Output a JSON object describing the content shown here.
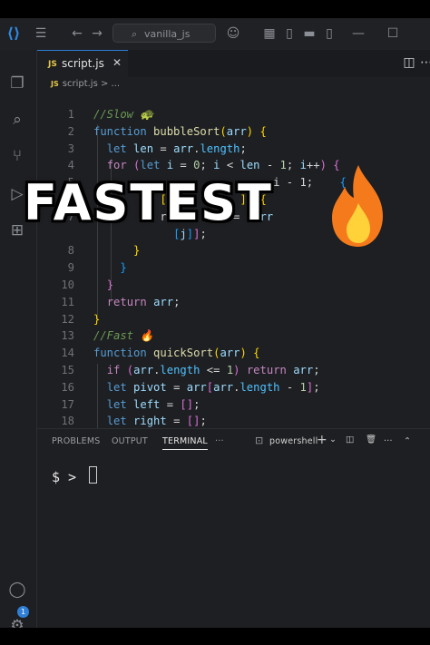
{
  "titlebar": {
    "search_text": "vanilla_js"
  },
  "tab": {
    "badge": "JS",
    "name": "script.js",
    "close": "✕"
  },
  "breadcrumb": {
    "file": "script.js",
    "trail": "> ..."
  },
  "code_lines": [
    {
      "n": "1",
      "html": "<span class='cm'>//Slow 🐢</span>"
    },
    {
      "n": "2",
      "html": "<span class='kb'>function</span> <span class='fn'>bubbleSort</span><span class='b1'>(</span><span class='vr'>arr</span><span class='b1'>)</span> <span class='b1'>{</span>"
    },
    {
      "n": "3",
      "html": "  <span class='kb'>let</span> <span class='vr'>len</span> = <span class='vr'>arr</span>.<span class='pr'>length</span>;"
    },
    {
      "n": "4",
      "html": "  <span class='kw'>for</span> <span class='b2'>(</span><span class='kb'>let</span> <span class='vr'>i</span> = <span class='nm'>0</span>; <span class='vr'>i</span> &lt; <span class='vr'>len</span> - <span class='nm'>1</span>; <span class='vr'>i</span>++<span class='b2'>)</span> <span class='b2'>{</span>"
    },
    {
      "n": "5",
      "html": "                           i - 1;    <span class='b3'>{</span>"
    },
    {
      "n": "6",
      "html": "          <span class='b1'>[</span>           <span class='b1'>])</span> <span class='b1'>{</span>"
    },
    {
      "n": "7",
      "html": "          r          = <span class='b2'>[</span><span class='vr'>arr</span>          <span class='vr'>arr</span>"
    },
    {
      "n": "",
      "html": "            <span class='b3'>[</span><span class='vr'>j</span><span class='b3'>]</span><span class='b2'>]</span>;"
    },
    {
      "n": "8",
      "html": "      <span class='b1'>}</span>"
    },
    {
      "n": "9",
      "html": "    <span class='b3'>}</span>"
    },
    {
      "n": "10",
      "html": "  <span class='b2'>}</span>"
    },
    {
      "n": "11",
      "html": "  <span class='kw'>return</span> <span class='vr'>arr</span>;"
    },
    {
      "n": "12",
      "html": "<span class='b1'>}</span>"
    },
    {
      "n": "13",
      "html": "<span class='cm'>//Fast 🔥</span>"
    },
    {
      "n": "14",
      "html": "<span class='kb'>function</span> <span class='fn'>quickSort</span><span class='b1'>(</span><span class='vr'>arr</span><span class='b1'>)</span> <span class='b1'>{</span>"
    },
    {
      "n": "15",
      "html": "  <span class='kw'>if</span> <span class='b2'>(</span><span class='vr'>arr</span>.<span class='pr'>length</span> &lt;= <span class='nm'>1</span><span class='b2'>)</span> <span class='kw'>return</span> <span class='vr'>arr</span>;"
    },
    {
      "n": "16",
      "html": "  <span class='kb'>let</span> <span class='vr'>pivot</span> = <span class='vr'>arr</span><span class='b2'>[</span><span class='vr'>arr</span>.<span class='pr'>length</span> - <span class='nm'>1</span><span class='b2'>]</span>;"
    },
    {
      "n": "17",
      "html": "  <span class='kb'>let</span> <span class='vr'>left</span> = <span class='b2'>[]</span>;"
    },
    {
      "n": "18",
      "html": "  <span class='kb'>let</span> <span class='vr'>right</span> = <span class='b2'>[]</span>;"
    },
    {
      "n": "19",
      "html": "  <span class='kw'>for</span> <span class='b2'>(</span><span class='kb'>let</span> <span class='vr'>i</span> = <span class='nm'>0</span>; <span class='vr'>i</span> &lt; <span class='vr'>arr</span>.<span class='pr'>length</span> - <span class='nm'>1</span>; <span class='vr'>i</span>++<span class='b2'>)</span> <span class='b2'>{</span>"
    }
  ],
  "panel": {
    "tabs": [
      "PROBLEMS",
      "OUTPUT",
      "TERMINAL",
      "···"
    ],
    "active_tab": "TERMINAL",
    "shell_name": "powershell",
    "prompt": "$ >"
  },
  "overlay": {
    "caption": "FASTEST"
  },
  "settings_badge": "1",
  "colors": {
    "accent": "#2f7fd6",
    "editor_bg": "#1e1f22",
    "fire_outer": "#f47a1c",
    "fire_inner": "#ffd23a"
  }
}
